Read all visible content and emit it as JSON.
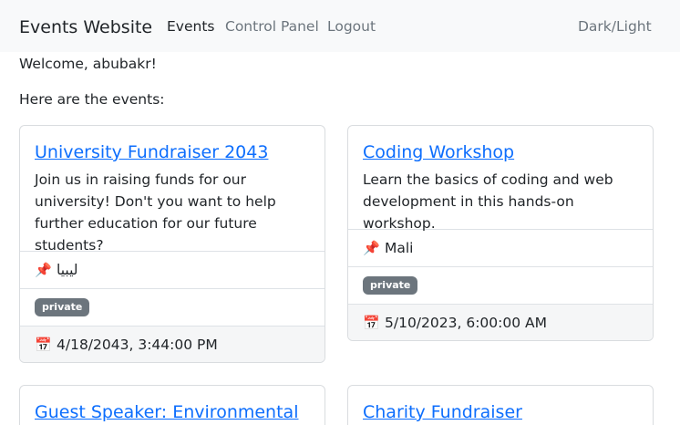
{
  "navbar": {
    "brand": "Events Website",
    "links": [
      {
        "label": "Events"
      },
      {
        "label": "Control Panel"
      },
      {
        "label": "Logout"
      }
    ],
    "theme_toggle": "Dark/Light"
  },
  "main": {
    "welcome": "Welcome, abubakr!",
    "intro": "Here are the events:"
  },
  "events": [
    {
      "title": "University Fundraiser 2043",
      "description": "Join us in raising funds for our university! Don't you want to help further education for our future students?",
      "location_icon": "pushpin-icon",
      "location_emoji": "📌",
      "location": "ليبيا",
      "badge": "private",
      "date_icon": "calendar-icon",
      "date_emoji": "📅",
      "date": "4/18/2043, 3:44:00 PM"
    },
    {
      "title": "Coding Workshop",
      "description": "Learn the basics of coding and web development in this hands-on workshop.",
      "location_icon": "pushpin-icon",
      "location_emoji": "📌",
      "location": "Mali",
      "badge": "private",
      "date_icon": "calendar-icon",
      "date_emoji": "📅",
      "date": "5/10/2023, 6:00:00 AM"
    },
    {
      "title": "Guest Speaker: Environmental"
    },
    {
      "title": "Charity Fundraiser"
    }
  ],
  "colors": {
    "link": "#0d6efd",
    "badge_bg": "#6c757d",
    "navbar_bg": "#f8f9fa",
    "footer_bg": "#f5f6f7"
  }
}
